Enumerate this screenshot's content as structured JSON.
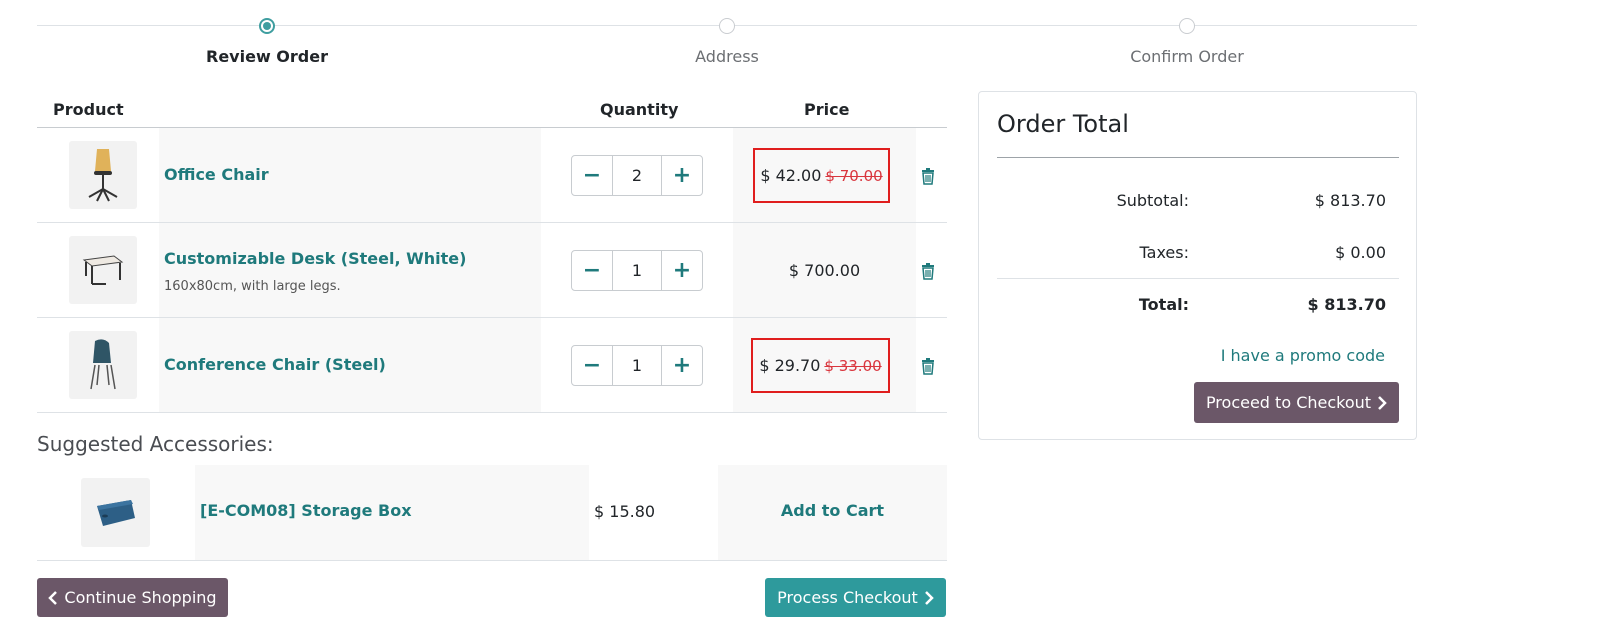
{
  "steps": [
    {
      "label": "Review Order",
      "active": true
    },
    {
      "label": "Address",
      "active": false
    },
    {
      "label": "Confirm Order",
      "active": false
    }
  ],
  "cart": {
    "headers": {
      "product": "Product",
      "quantity": "Quantity",
      "price": "Price"
    },
    "items": [
      {
        "name": "Office Chair",
        "description": "",
        "quantity": "2",
        "price": "$ 42.00",
        "old_price": "$ 70.00",
        "icon": "office-chair-image"
      },
      {
        "name": "Customizable Desk (Steel, White)",
        "description": "160x80cm, with large legs.",
        "quantity": "1",
        "price": "$ 700.00",
        "old_price": "",
        "icon": "desk-image"
      },
      {
        "name": "Conference Chair (Steel)",
        "description": "",
        "quantity": "1",
        "price": "$ 29.70",
        "old_price": "$ 33.00",
        "icon": "conference-chair-image"
      }
    ]
  },
  "suggested": {
    "title": "Suggested Accessories:",
    "items": [
      {
        "name": "[E-COM08] Storage Box",
        "price": "$ 15.80",
        "action": "Add to Cart",
        "icon": "storage-box-image"
      }
    ]
  },
  "buttons": {
    "continue": "Continue Shopping",
    "process": "Process Checkout"
  },
  "order_total": {
    "title": "Order Total",
    "subtotal_label": "Subtotal:",
    "subtotal_value": "$ 813.70",
    "taxes_label": "Taxes:",
    "taxes_value": "$ 0.00",
    "total_label": "Total:",
    "total_value": "$ 813.70",
    "promo": "I have a promo code",
    "proceed": "Proceed to Checkout"
  },
  "colors": {
    "teal": "#1f7a7c",
    "accent": "#2e9a9c",
    "mauve": "#6b5768",
    "strike_red": "#d9363e",
    "highlight_red": "#e01e1e"
  }
}
